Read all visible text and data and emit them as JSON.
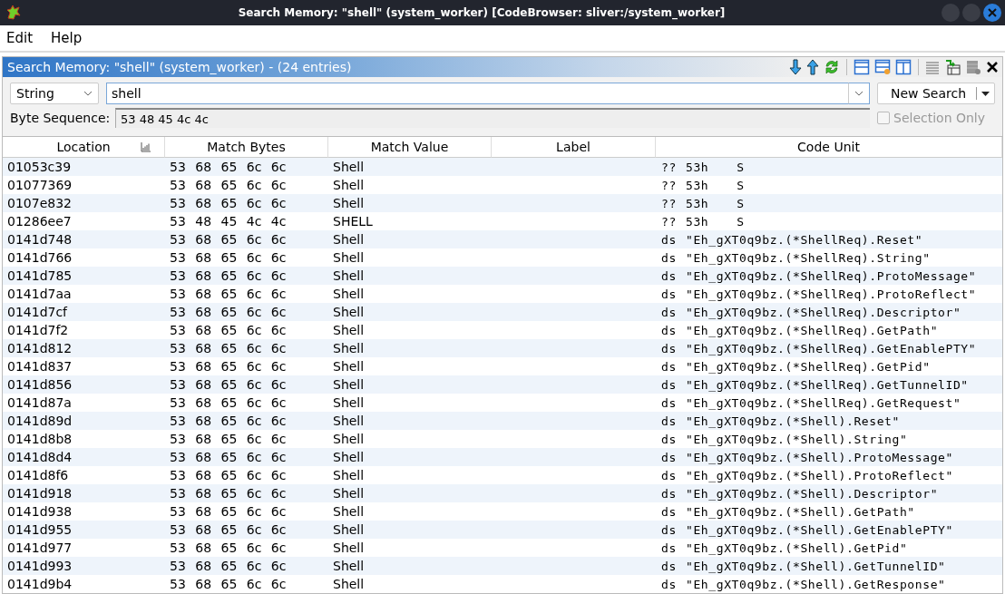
{
  "window": {
    "title": "Search Memory: \"shell\"  (system_worker) [CodeBrowser: sliver:/system_worker]"
  },
  "menu": [
    "Edit",
    "Help"
  ],
  "panel": {
    "title": "Search Memory: \"shell\"  (system_worker) -  (24 entries)"
  },
  "search": {
    "type": "String",
    "value": "shell",
    "byte_sequence_label": "Byte Sequence:",
    "byte_sequence": "53 48 45 4c 4c",
    "new_search": "New Search",
    "selection_only": {
      "label": "Selection Only",
      "checked": false,
      "disabled": true
    }
  },
  "table": {
    "columns": [
      "Location",
      "Match Bytes",
      "Match Value",
      "Label",
      "Code Unit"
    ],
    "rows": [
      {
        "location": "01053c39",
        "bytes": "53 68 65 6c 6c",
        "value": "Shell",
        "mnemonic": "??",
        "operand": "53h",
        "char": "S"
      },
      {
        "location": "01077369",
        "bytes": "53 68 65 6c 6c",
        "value": "Shell",
        "mnemonic": "??",
        "operand": "53h",
        "char": "S"
      },
      {
        "location": "0107e832",
        "bytes": "53 68 65 6c 6c",
        "value": "Shell",
        "mnemonic": "??",
        "operand": "53h",
        "char": "S"
      },
      {
        "location": "01286ee7",
        "bytes": "53 48 45 4c 4c",
        "value": "SHELL",
        "mnemonic": "??",
        "operand": "53h",
        "char": "S"
      },
      {
        "location": "0141d748",
        "bytes": "53 68 65 6c 6c",
        "value": "Shell",
        "mnemonic": "ds",
        "operand": "\"Eh_gXT0q9bz.(*ShellReq).Reset\""
      },
      {
        "location": "0141d766",
        "bytes": "53 68 65 6c 6c",
        "value": "Shell",
        "mnemonic": "ds",
        "operand": "\"Eh_gXT0q9bz.(*ShellReq).String\""
      },
      {
        "location": "0141d785",
        "bytes": "53 68 65 6c 6c",
        "value": "Shell",
        "mnemonic": "ds",
        "operand": "\"Eh_gXT0q9bz.(*ShellReq).ProtoMessage\""
      },
      {
        "location": "0141d7aa",
        "bytes": "53 68 65 6c 6c",
        "value": "Shell",
        "mnemonic": "ds",
        "operand": "\"Eh_gXT0q9bz.(*ShellReq).ProtoReflect\""
      },
      {
        "location": "0141d7cf",
        "bytes": "53 68 65 6c 6c",
        "value": "Shell",
        "mnemonic": "ds",
        "operand": "\"Eh_gXT0q9bz.(*ShellReq).Descriptor\""
      },
      {
        "location": "0141d7f2",
        "bytes": "53 68 65 6c 6c",
        "value": "Shell",
        "mnemonic": "ds",
        "operand": "\"Eh_gXT0q9bz.(*ShellReq).GetPath\""
      },
      {
        "location": "0141d812",
        "bytes": "53 68 65 6c 6c",
        "value": "Shell",
        "mnemonic": "ds",
        "operand": "\"Eh_gXT0q9bz.(*ShellReq).GetEnablePTY\""
      },
      {
        "location": "0141d837",
        "bytes": "53 68 65 6c 6c",
        "value": "Shell",
        "mnemonic": "ds",
        "operand": "\"Eh_gXT0q9bz.(*ShellReq).GetPid\""
      },
      {
        "location": "0141d856",
        "bytes": "53 68 65 6c 6c",
        "value": "Shell",
        "mnemonic": "ds",
        "operand": "\"Eh_gXT0q9bz.(*ShellReq).GetTunnelID\""
      },
      {
        "location": "0141d87a",
        "bytes": "53 68 65 6c 6c",
        "value": "Shell",
        "mnemonic": "ds",
        "operand": "\"Eh_gXT0q9bz.(*ShellReq).GetRequest\""
      },
      {
        "location": "0141d89d",
        "bytes": "53 68 65 6c 6c",
        "value": "Shell",
        "mnemonic": "ds",
        "operand": "\"Eh_gXT0q9bz.(*Shell).Reset\""
      },
      {
        "location": "0141d8b8",
        "bytes": "53 68 65 6c 6c",
        "value": "Shell",
        "mnemonic": "ds",
        "operand": "\"Eh_gXT0q9bz.(*Shell).String\""
      },
      {
        "location": "0141d8d4",
        "bytes": "53 68 65 6c 6c",
        "value": "Shell",
        "mnemonic": "ds",
        "operand": "\"Eh_gXT0q9bz.(*Shell).ProtoMessage\""
      },
      {
        "location": "0141d8f6",
        "bytes": "53 68 65 6c 6c",
        "value": "Shell",
        "mnemonic": "ds",
        "operand": "\"Eh_gXT0q9bz.(*Shell).ProtoReflect\""
      },
      {
        "location": "0141d918",
        "bytes": "53 68 65 6c 6c",
        "value": "Shell",
        "mnemonic": "ds",
        "operand": "\"Eh_gXT0q9bz.(*Shell).Descriptor\""
      },
      {
        "location": "0141d938",
        "bytes": "53 68 65 6c 6c",
        "value": "Shell",
        "mnemonic": "ds",
        "operand": "\"Eh_gXT0q9bz.(*Shell).GetPath\""
      },
      {
        "location": "0141d955",
        "bytes": "53 68 65 6c 6c",
        "value": "Shell",
        "mnemonic": "ds",
        "operand": "\"Eh_gXT0q9bz.(*Shell).GetEnablePTY\""
      },
      {
        "location": "0141d977",
        "bytes": "53 68 65 6c 6c",
        "value": "Shell",
        "mnemonic": "ds",
        "operand": "\"Eh_gXT0q9bz.(*Shell).GetPid\""
      },
      {
        "location": "0141d993",
        "bytes": "53 68 65 6c 6c",
        "value": "Shell",
        "mnemonic": "ds",
        "operand": "\"Eh_gXT0q9bz.(*Shell).GetTunnelID\""
      },
      {
        "location": "0141d9b4",
        "bytes": "53 68 65 6c 6c",
        "value": "Shell",
        "mnemonic": "ds",
        "operand": "\"Eh_gXT0q9bz.(*Shell).GetResponse\""
      }
    ]
  }
}
